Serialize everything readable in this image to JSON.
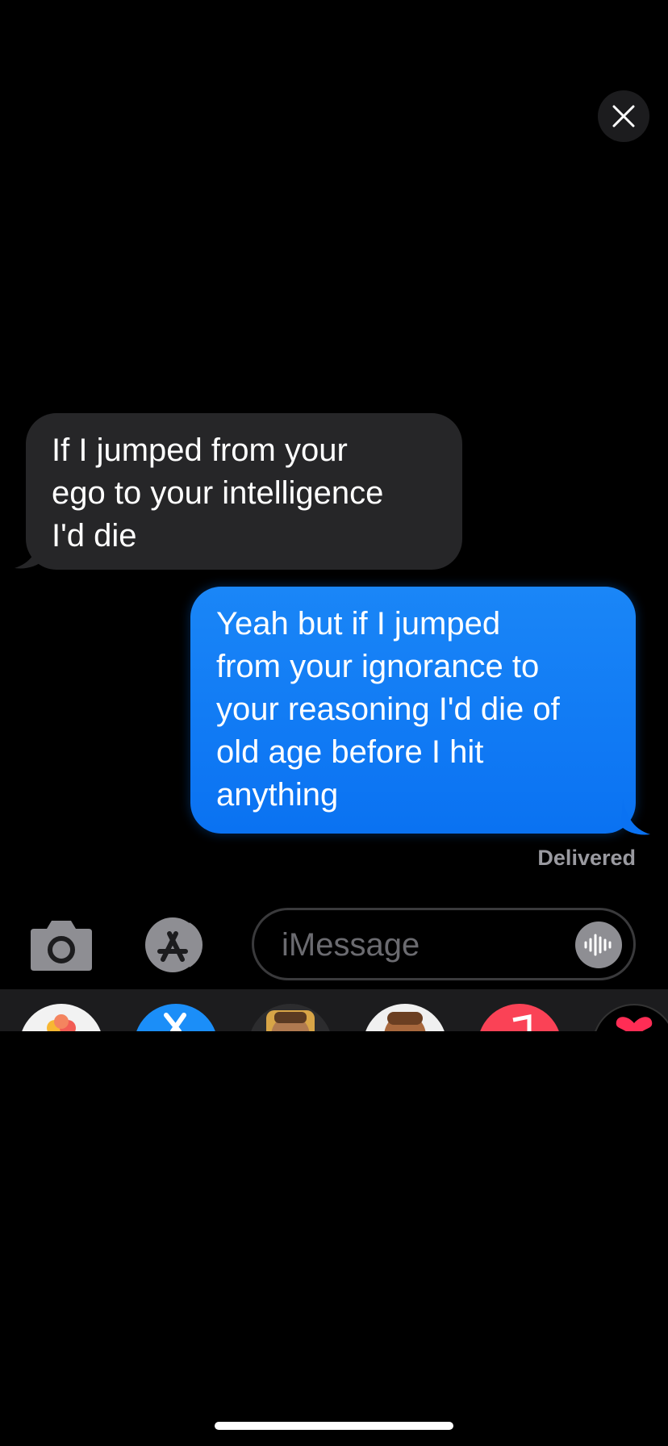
{
  "conversation": {
    "received_message": {
      "lines": [
        "If I jumped from your",
        "ego to your intelligence",
        "I'd die"
      ]
    },
    "sent_message": {
      "lines": [
        "Yeah but if I jumped",
        "from your ignorance to",
        "your reasoning I'd die of",
        "old age before I hit",
        "anything"
      ]
    },
    "status": "Delivered"
  },
  "composer": {
    "placeholder": "iMessage",
    "camera_icon": "camera-icon",
    "apps_icon": "app-store-icon",
    "audio_icon": "waveform-icon"
  },
  "app_drawer": {
    "apps": [
      "photos-icon",
      "app-store-icon",
      "memoji-icon",
      "memoji-stickers-icon",
      "music-icon",
      "digital-touch-icon"
    ]
  },
  "colors": {
    "background": "#000000",
    "received_bubble": "#262628",
    "sent_bubble": "#0a72f2",
    "status_text": "#9a9aa0"
  }
}
